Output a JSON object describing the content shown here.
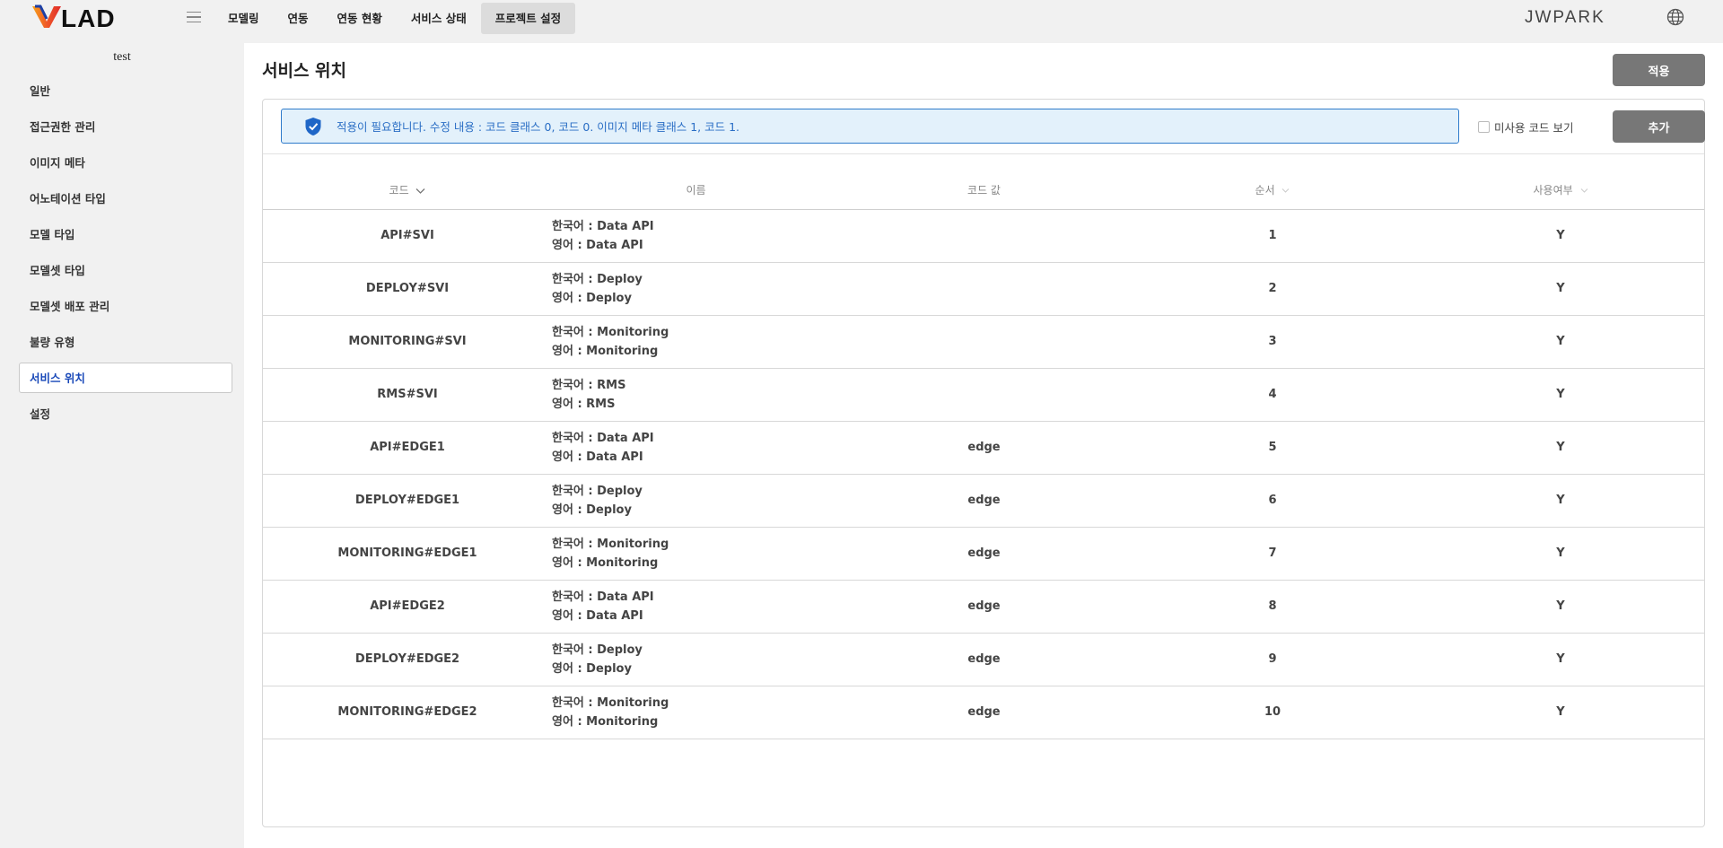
{
  "header": {
    "logo_text": "VLAD",
    "nav": [
      {
        "label": "모델링",
        "active": false
      },
      {
        "label": "연동",
        "active": false
      },
      {
        "label": "연동 현황",
        "active": false
      },
      {
        "label": "서비스 상태",
        "active": false
      },
      {
        "label": "프로젝트 설정",
        "active": true
      }
    ],
    "user": "JWPARK",
    "icons": {
      "menu": "hamburger-icon",
      "language": "globe-icon"
    }
  },
  "sidebar": {
    "project": "test",
    "items": [
      {
        "label": "일반",
        "active": false
      },
      {
        "label": "접근권한 관리",
        "active": false
      },
      {
        "label": "이미지 메타",
        "active": false
      },
      {
        "label": "어노테이션 타입",
        "active": false
      },
      {
        "label": "모델 타입",
        "active": false
      },
      {
        "label": "모델셋 타입",
        "active": false
      },
      {
        "label": "모델셋 배포 관리",
        "active": false
      },
      {
        "label": "불량 유형",
        "active": false
      },
      {
        "label": "서비스 위치",
        "active": true
      },
      {
        "label": "설정",
        "active": false
      }
    ]
  },
  "main": {
    "title": "서비스 위치",
    "apply_label": "적용",
    "notice": "적용이 필요합니다. 수정 내용 : 코드 클래스 0, 코드 0. 이미지 메타 클래스 1, 코드 1.",
    "unused_label": "미사용 코드 보기",
    "add_label": "추가",
    "columns": [
      "코드",
      "이름",
      "코드 값",
      "순서",
      "사용여부"
    ],
    "rows": [
      {
        "code": "API#SVI",
        "ko": "한국어 : Data API",
        "en": "영어 : Data API",
        "value": "",
        "order": "1",
        "use": "Y"
      },
      {
        "code": "DEPLOY#SVI",
        "ko": "한국어 : Deploy",
        "en": "영어 : Deploy",
        "value": "",
        "order": "2",
        "use": "Y"
      },
      {
        "code": "MONITORING#SVI",
        "ko": "한국어 : Monitoring",
        "en": "영어 : Monitoring",
        "value": "",
        "order": "3",
        "use": "Y"
      },
      {
        "code": "RMS#SVI",
        "ko": "한국어 : RMS",
        "en": "영어 : RMS",
        "value": "",
        "order": "4",
        "use": "Y"
      },
      {
        "code": "API#EDGE1",
        "ko": "한국어 : Data API",
        "en": "영어 : Data API",
        "value": "edge",
        "order": "5",
        "use": "Y"
      },
      {
        "code": "DEPLOY#EDGE1",
        "ko": "한국어 : Deploy",
        "en": "영어 : Deploy",
        "value": "edge",
        "order": "6",
        "use": "Y"
      },
      {
        "code": "MONITORING#EDGE1",
        "ko": "한국어 : Monitoring",
        "en": "영어 : Monitoring",
        "value": "edge",
        "order": "7",
        "use": "Y"
      },
      {
        "code": "API#EDGE2",
        "ko": "한국어 : Data API",
        "en": "영어 : Data API",
        "value": "edge",
        "order": "8",
        "use": "Y"
      },
      {
        "code": "DEPLOY#EDGE2",
        "ko": "한국어 : Deploy",
        "en": "영어 : Deploy",
        "value": "edge",
        "order": "9",
        "use": "Y"
      },
      {
        "code": "MONITORING#EDGE2",
        "ko": "한국어 : Monitoring",
        "en": "영어 : Monitoring",
        "value": "edge",
        "order": "10",
        "use": "Y"
      }
    ]
  },
  "colors": {
    "accent": "#1747b8",
    "notice_bg": "#e3f1fb",
    "notice_border": "#2f7bcb",
    "button": "#777777"
  }
}
